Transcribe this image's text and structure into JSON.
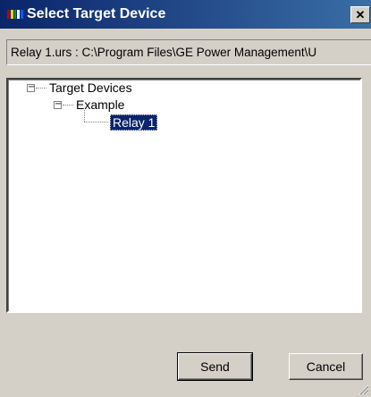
{
  "window": {
    "title": "Select Target Device",
    "close_glyph": "✕"
  },
  "path_field": {
    "value": "Relay 1.urs : C:\\Program Files\\GE Power Management\\U"
  },
  "tree": {
    "root_label": "Target Devices",
    "child_label": "Example",
    "leaf_label": "Relay 1",
    "expander_glyph": "−"
  },
  "buttons": {
    "send_label": "Send",
    "cancel_label": "Cancel"
  },
  "colors": {
    "titlebar_start": "#0a246a",
    "titlebar_end": "#3a6ea5",
    "selection": "#0a246a",
    "dialog_face": "#d4d0c8"
  }
}
